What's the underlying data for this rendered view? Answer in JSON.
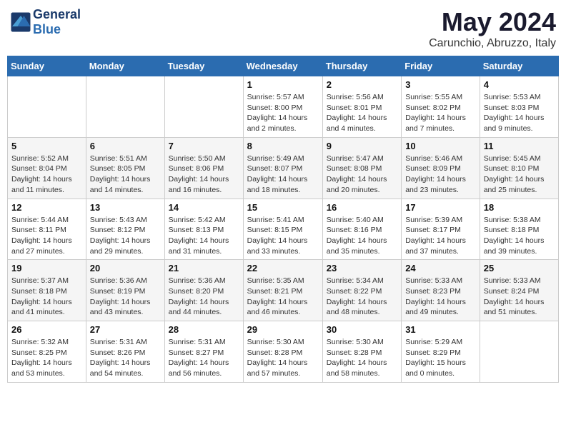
{
  "logo": {
    "general": "General",
    "blue": "Blue"
  },
  "header": {
    "month_year": "May 2024",
    "location": "Carunchio, Abruzzo, Italy"
  },
  "weekdays": [
    "Sunday",
    "Monday",
    "Tuesday",
    "Wednesday",
    "Thursday",
    "Friday",
    "Saturday"
  ],
  "weeks": [
    [
      {
        "day": "",
        "lines": []
      },
      {
        "day": "",
        "lines": []
      },
      {
        "day": "",
        "lines": []
      },
      {
        "day": "1",
        "lines": [
          "Sunrise: 5:57 AM",
          "Sunset: 8:00 PM",
          "Daylight: 14 hours",
          "and 2 minutes."
        ]
      },
      {
        "day": "2",
        "lines": [
          "Sunrise: 5:56 AM",
          "Sunset: 8:01 PM",
          "Daylight: 14 hours",
          "and 4 minutes."
        ]
      },
      {
        "day": "3",
        "lines": [
          "Sunrise: 5:55 AM",
          "Sunset: 8:02 PM",
          "Daylight: 14 hours",
          "and 7 minutes."
        ]
      },
      {
        "day": "4",
        "lines": [
          "Sunrise: 5:53 AM",
          "Sunset: 8:03 PM",
          "Daylight: 14 hours",
          "and 9 minutes."
        ]
      }
    ],
    [
      {
        "day": "5",
        "lines": [
          "Sunrise: 5:52 AM",
          "Sunset: 8:04 PM",
          "Daylight: 14 hours",
          "and 11 minutes."
        ]
      },
      {
        "day": "6",
        "lines": [
          "Sunrise: 5:51 AM",
          "Sunset: 8:05 PM",
          "Daylight: 14 hours",
          "and 14 minutes."
        ]
      },
      {
        "day": "7",
        "lines": [
          "Sunrise: 5:50 AM",
          "Sunset: 8:06 PM",
          "Daylight: 14 hours",
          "and 16 minutes."
        ]
      },
      {
        "day": "8",
        "lines": [
          "Sunrise: 5:49 AM",
          "Sunset: 8:07 PM",
          "Daylight: 14 hours",
          "and 18 minutes."
        ]
      },
      {
        "day": "9",
        "lines": [
          "Sunrise: 5:47 AM",
          "Sunset: 8:08 PM",
          "Daylight: 14 hours",
          "and 20 minutes."
        ]
      },
      {
        "day": "10",
        "lines": [
          "Sunrise: 5:46 AM",
          "Sunset: 8:09 PM",
          "Daylight: 14 hours",
          "and 23 minutes."
        ]
      },
      {
        "day": "11",
        "lines": [
          "Sunrise: 5:45 AM",
          "Sunset: 8:10 PM",
          "Daylight: 14 hours",
          "and 25 minutes."
        ]
      }
    ],
    [
      {
        "day": "12",
        "lines": [
          "Sunrise: 5:44 AM",
          "Sunset: 8:11 PM",
          "Daylight: 14 hours",
          "and 27 minutes."
        ]
      },
      {
        "day": "13",
        "lines": [
          "Sunrise: 5:43 AM",
          "Sunset: 8:12 PM",
          "Daylight: 14 hours",
          "and 29 minutes."
        ]
      },
      {
        "day": "14",
        "lines": [
          "Sunrise: 5:42 AM",
          "Sunset: 8:13 PM",
          "Daylight: 14 hours",
          "and 31 minutes."
        ]
      },
      {
        "day": "15",
        "lines": [
          "Sunrise: 5:41 AM",
          "Sunset: 8:15 PM",
          "Daylight: 14 hours",
          "and 33 minutes."
        ]
      },
      {
        "day": "16",
        "lines": [
          "Sunrise: 5:40 AM",
          "Sunset: 8:16 PM",
          "Daylight: 14 hours",
          "and 35 minutes."
        ]
      },
      {
        "day": "17",
        "lines": [
          "Sunrise: 5:39 AM",
          "Sunset: 8:17 PM",
          "Daylight: 14 hours",
          "and 37 minutes."
        ]
      },
      {
        "day": "18",
        "lines": [
          "Sunrise: 5:38 AM",
          "Sunset: 8:18 PM",
          "Daylight: 14 hours",
          "and 39 minutes."
        ]
      }
    ],
    [
      {
        "day": "19",
        "lines": [
          "Sunrise: 5:37 AM",
          "Sunset: 8:18 PM",
          "Daylight: 14 hours",
          "and 41 minutes."
        ]
      },
      {
        "day": "20",
        "lines": [
          "Sunrise: 5:36 AM",
          "Sunset: 8:19 PM",
          "Daylight: 14 hours",
          "and 43 minutes."
        ]
      },
      {
        "day": "21",
        "lines": [
          "Sunrise: 5:36 AM",
          "Sunset: 8:20 PM",
          "Daylight: 14 hours",
          "and 44 minutes."
        ]
      },
      {
        "day": "22",
        "lines": [
          "Sunrise: 5:35 AM",
          "Sunset: 8:21 PM",
          "Daylight: 14 hours",
          "and 46 minutes."
        ]
      },
      {
        "day": "23",
        "lines": [
          "Sunrise: 5:34 AM",
          "Sunset: 8:22 PM",
          "Daylight: 14 hours",
          "and 48 minutes."
        ]
      },
      {
        "day": "24",
        "lines": [
          "Sunrise: 5:33 AM",
          "Sunset: 8:23 PM",
          "Daylight: 14 hours",
          "and 49 minutes."
        ]
      },
      {
        "day": "25",
        "lines": [
          "Sunrise: 5:33 AM",
          "Sunset: 8:24 PM",
          "Daylight: 14 hours",
          "and 51 minutes."
        ]
      }
    ],
    [
      {
        "day": "26",
        "lines": [
          "Sunrise: 5:32 AM",
          "Sunset: 8:25 PM",
          "Daylight: 14 hours",
          "and 53 minutes."
        ]
      },
      {
        "day": "27",
        "lines": [
          "Sunrise: 5:31 AM",
          "Sunset: 8:26 PM",
          "Daylight: 14 hours",
          "and 54 minutes."
        ]
      },
      {
        "day": "28",
        "lines": [
          "Sunrise: 5:31 AM",
          "Sunset: 8:27 PM",
          "Daylight: 14 hours",
          "and 56 minutes."
        ]
      },
      {
        "day": "29",
        "lines": [
          "Sunrise: 5:30 AM",
          "Sunset: 8:28 PM",
          "Daylight: 14 hours",
          "and 57 minutes."
        ]
      },
      {
        "day": "30",
        "lines": [
          "Sunrise: 5:30 AM",
          "Sunset: 8:28 PM",
          "Daylight: 14 hours",
          "and 58 minutes."
        ]
      },
      {
        "day": "31",
        "lines": [
          "Sunrise: 5:29 AM",
          "Sunset: 8:29 PM",
          "Daylight: 15 hours",
          "and 0 minutes."
        ]
      },
      {
        "day": "",
        "lines": []
      }
    ]
  ]
}
